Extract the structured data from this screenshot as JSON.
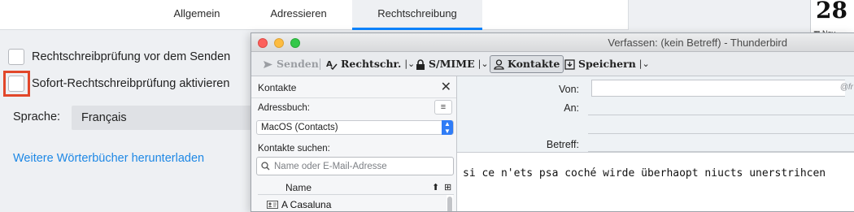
{
  "prefs": {
    "tabs": [
      {
        "label": "Allgemein"
      },
      {
        "label": "Adressieren"
      },
      {
        "label": "Rechtschreibung"
      }
    ],
    "check_before_send_label": "Rechtschreibprüfung vor dem Senden",
    "check_before_send_checked": false,
    "instant_check_label": "Sofort-Rechtschreibprüfung aktivieren",
    "instant_check_checked": false,
    "language_label": "Sprache:",
    "language_value": "Français",
    "download_link": "Weitere Wörterbücher herunterladen",
    "highlight_color": "#e2472a",
    "accent_color": "#0a84ff"
  },
  "calendar": {
    "day_number": "28",
    "day_label": "Nov"
  },
  "compose": {
    "title": "Verfassen: (kein Betreff) - Thunderbird",
    "toolbar": {
      "send_label": "Senden",
      "spelling_label": "Rechtschr.",
      "smime_label": "S/MIME",
      "contacts_label": "Kontakte",
      "save_label": "Speichern"
    },
    "sidebar": {
      "title": "Kontakte",
      "addressbook_label": "Adressbuch:",
      "addressbook_value": "MacOS (Contacts)",
      "search_label": "Kontakte suchen:",
      "search_placeholder": "Name oder E-Mail-Adresse",
      "column_name": "Name",
      "contacts": [
        {
          "name": "A Casaluna"
        }
      ]
    },
    "header": {
      "from_label": "Von:",
      "from_ghost": "@fr",
      "to_label": "An:",
      "subject_label": "Betreff:"
    },
    "body_text": "si ce n'ets psa coché wirde überhaopt niucts unerstrihcen"
  }
}
